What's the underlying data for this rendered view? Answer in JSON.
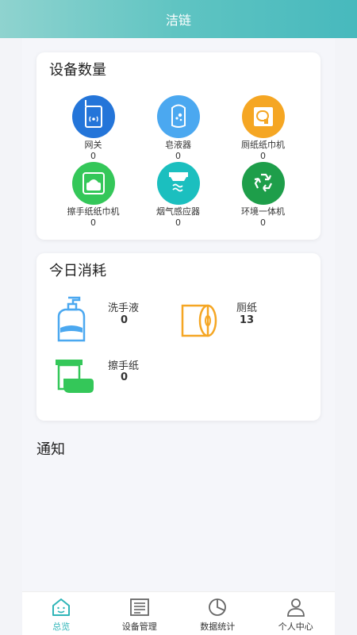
{
  "header": {
    "title": "洁链"
  },
  "device_card": {
    "title": "设备数量",
    "items": [
      {
        "label": "网关",
        "count": "0",
        "icon": "gateway-icon",
        "color": "#2475d9"
      },
      {
        "label": "皂液器",
        "count": "0",
        "icon": "soap-dispenser-icon",
        "color": "#4ba8f0"
      },
      {
        "label": "厕纸纸巾机",
        "count": "0",
        "icon": "toilet-paper-icon",
        "color": "#f5a623"
      },
      {
        "label": "擦手纸纸巾机",
        "count": "0",
        "icon": "tissue-box-icon",
        "color": "#34c759"
      },
      {
        "label": "烟气感应器",
        "count": "0",
        "icon": "smoke-sensor-icon",
        "color": "#1bbfbf"
      },
      {
        "label": "环境一体机",
        "count": "0",
        "icon": "recycle-icon",
        "color": "#1e9e4a"
      }
    ]
  },
  "consumption_card": {
    "title": "今日消耗",
    "items": [
      {
        "label": "洗手液",
        "value": "0",
        "icon": "hand-soap-icon"
      },
      {
        "label": "厕纸",
        "value": "13",
        "icon": "toilet-roll-icon"
      },
      {
        "label": "擦手纸",
        "value": "0",
        "icon": "hand-towel-icon"
      }
    ]
  },
  "notice": {
    "title": "通知"
  },
  "tabbar": {
    "tabs": [
      {
        "label": "总览",
        "icon": "home-icon",
        "active": true
      },
      {
        "label": "设备管理",
        "icon": "device-list-icon",
        "active": false
      },
      {
        "label": "数据统计",
        "icon": "pie-chart-icon",
        "active": false
      },
      {
        "label": "个人中心",
        "icon": "user-icon",
        "active": false
      }
    ]
  }
}
